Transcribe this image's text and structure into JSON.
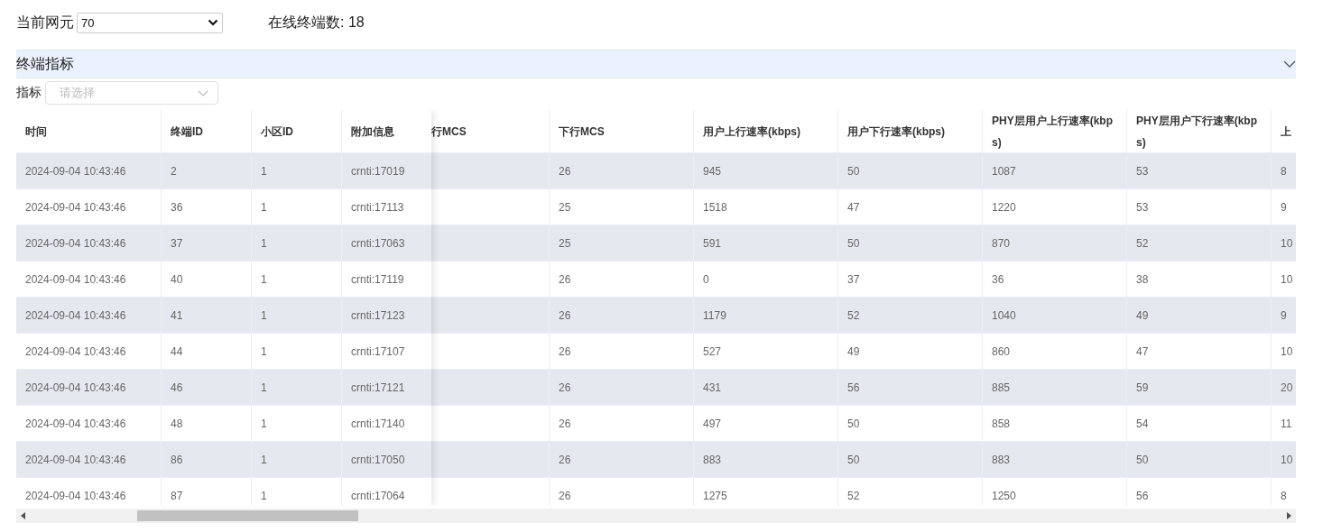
{
  "toolbar": {
    "ne_label": "当前网元",
    "ne_value": "70",
    "online_label": "在线终端数: 18"
  },
  "panel": {
    "title": "终端指标",
    "expanded": true
  },
  "filter": {
    "label": "指标",
    "placeholder": "请选择"
  },
  "table": {
    "columns": [
      {
        "title": "时间",
        "kind": "pinned"
      },
      {
        "title": "终端ID",
        "kind": "pinned"
      },
      {
        "title": "小区ID",
        "kind": "pinned"
      },
      {
        "title": "附加信息",
        "kind": "pinned"
      },
      {
        "title": "行MCS",
        "kind": "covered"
      },
      {
        "title": "下行MCS",
        "kind": "plain"
      },
      {
        "title": "用户上行速率(kbps)",
        "kind": "plain"
      },
      {
        "title": "用户下行速率(kbps)",
        "kind": "plain"
      },
      {
        "title": "PHY层用户上行速率(kbps)",
        "kind": "plain"
      },
      {
        "title": "PHY层用户下行速率(kbps)",
        "kind": "plain"
      },
      {
        "title": "上",
        "kind": "edge"
      }
    ],
    "rows": [
      {
        "cells": [
          "2024-09-04 10:43:46",
          "2",
          "1",
          "crnti:17019",
          "",
          "26",
          "945",
          "50",
          "1087",
          "53",
          "8"
        ]
      },
      {
        "cells": [
          "2024-09-04 10:43:46",
          "36",
          "1",
          "crnti:17113",
          "",
          "25",
          "1518",
          "47",
          "1220",
          "53",
          "9"
        ]
      },
      {
        "cells": [
          "2024-09-04 10:43:46",
          "37",
          "1",
          "crnti:17063",
          "",
          "25",
          "591",
          "50",
          "870",
          "52",
          "10"
        ]
      },
      {
        "cells": [
          "2024-09-04 10:43:46",
          "40",
          "1",
          "crnti:17119",
          "",
          "26",
          "0",
          "37",
          "36",
          "38",
          "10"
        ]
      },
      {
        "cells": [
          "2024-09-04 10:43:46",
          "41",
          "1",
          "crnti:17123",
          "",
          "26",
          "1179",
          "52",
          "1040",
          "49",
          "9"
        ]
      },
      {
        "cells": [
          "2024-09-04 10:43:46",
          "44",
          "1",
          "crnti:17107",
          "",
          "26",
          "527",
          "49",
          "860",
          "47",
          "10"
        ]
      },
      {
        "cells": [
          "2024-09-04 10:43:46",
          "46",
          "1",
          "crnti:17121",
          "",
          "26",
          "431",
          "56",
          "885",
          "59",
          "20"
        ]
      },
      {
        "cells": [
          "2024-09-04 10:43:46",
          "48",
          "1",
          "crnti:17140",
          "",
          "26",
          "497",
          "50",
          "858",
          "54",
          "11"
        ]
      },
      {
        "cells": [
          "2024-09-04 10:43:46",
          "86",
          "1",
          "crnti:17050",
          "",
          "26",
          "883",
          "50",
          "883",
          "50",
          "10"
        ]
      },
      {
        "cells": [
          "2024-09-04 10:43:46",
          "87",
          "1",
          "crnti:17064",
          "",
          "26",
          "1275",
          "52",
          "1250",
          "56",
          "8"
        ]
      }
    ]
  }
}
